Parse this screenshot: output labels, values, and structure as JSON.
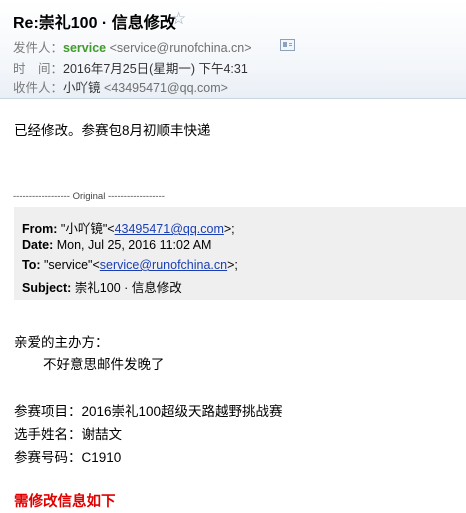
{
  "header": {
    "subject": "Re:崇礼100 · 信息修改",
    "star_icon": "star-outline-icon",
    "from_label": "发件人：",
    "from_name": "service",
    "from_address": "<service@runofchina.cn>",
    "time_label": "时　间：",
    "time_value": "2016年7月25日(星期一) 下午4:31",
    "to_label": "收件人：",
    "to_name": "小吖镜",
    "to_address": "<43495471@qq.com>"
  },
  "body": {
    "reply": "已经修改。参赛包8月初顺丰快递",
    "original_separator": "------------------ Original ------------------"
  },
  "quote": {
    "from_label": "From:",
    "from_name": " \"小吖镜\"<",
    "from_email": "43495471@qq.com",
    "from_tail": ">;",
    "date_label": "Date:",
    "date_value": " Mon, Jul 25, 2016 11:02 AM",
    "to_label": "To:",
    "to_name": " \"service\"<",
    "to_email": "service@runofchina.cn",
    "to_tail": ">;",
    "subject_label": "Subject:",
    "subject_value": " 崇礼100 · 信息修改"
  },
  "message": {
    "greeting": "亲爱的主办方：",
    "apology": "不好意思邮件发晚了",
    "event": "参赛项目：2016崇礼100超级天路越野挑战赛",
    "name": "选手姓名：谢喆文",
    "number": "参赛号码：C1910",
    "change_title": "需修改信息如下"
  },
  "colors": {
    "sender": "#3f9b2a",
    "link": "#1a3fb4",
    "highlight": "#e00000"
  }
}
